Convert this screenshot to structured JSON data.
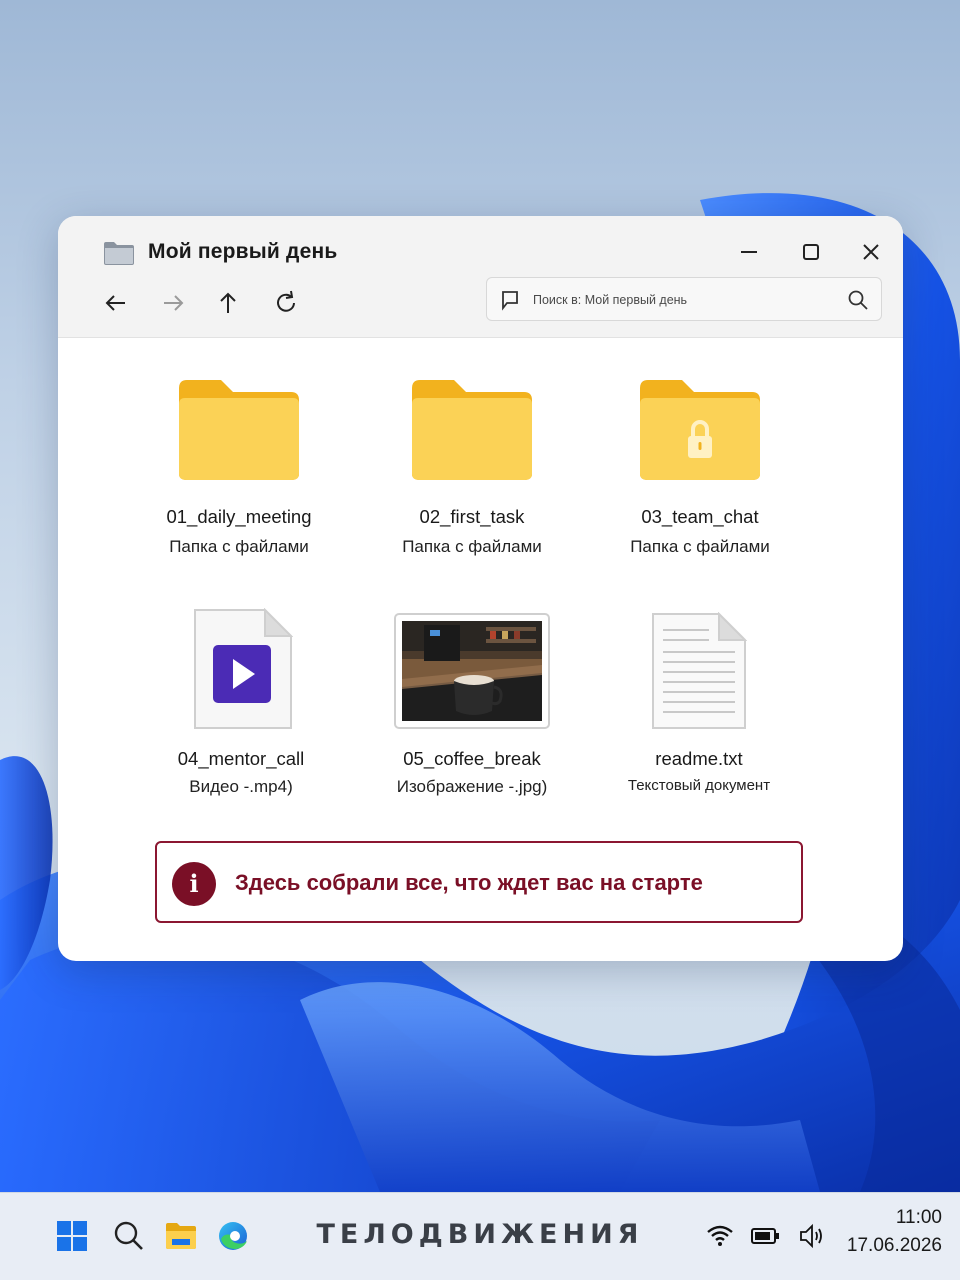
{
  "window": {
    "title": "Мой первый день",
    "search_placeholder": "Поиск в: Мой первый день"
  },
  "icons": {
    "folder": "folder-icon",
    "minimize": "minimize-icon",
    "maximize": "maximize-icon",
    "close": "close-icon",
    "back": "arrow-left-icon",
    "forward": "arrow-right-icon",
    "up": "arrow-up-icon",
    "refresh": "refresh-icon",
    "search": "search-icon"
  },
  "files": [
    {
      "name": "01_daily_meeting",
      "type": "Папка с файлами",
      "icon": "folder-icon"
    },
    {
      "name": "02_first_task",
      "type": "Папка с файлами",
      "icon": "folder-icon"
    },
    {
      "name": "03_team_chat",
      "type": "Папка с файлами",
      "icon": "locked-folder-icon"
    },
    {
      "name": "04_mentor_call",
      "type": "Видео -.mp4)",
      "icon": "video-file-icon"
    },
    {
      "name": "05_coffee_break",
      "type": "Изображение -.jpg)",
      "icon": "image-thumbnail-icon"
    },
    {
      "name": "readme.txt",
      "type": "Текстовый документ",
      "icon": "text-file-icon"
    }
  ],
  "banner": {
    "icon_text": "i",
    "text": "Здесь собрали все, что ждет вас на старте"
  },
  "taskbar": {
    "brand": "ТЕЛОДВИЖЕНИЯ",
    "time": "11:00",
    "date": "17.06.2026"
  },
  "colors": {
    "folder_yellow": "#f9c83a",
    "accent_maroon": "#7a0f26",
    "wallpaper_blue": "#1456e0"
  }
}
